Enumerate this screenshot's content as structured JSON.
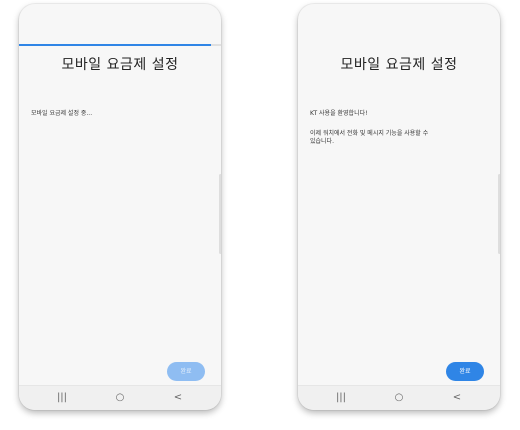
{
  "screens": [
    {
      "title": "모바일 요금제 설정",
      "progress_percent": 95,
      "lines": [
        "모바일 요금제 설정 중..."
      ],
      "done_label": "완료",
      "done_enabled": false
    },
    {
      "title": "모바일 요금제 설정",
      "lines": [
        "KT 사용을 환영합니다!",
        "이제 워치에서 전화 및 메시지 기능을 사용할 수",
        "있습니다."
      ],
      "done_label": "완료",
      "done_enabled": true
    }
  ],
  "nav": {
    "recent": "|||",
    "home": "○",
    "back": "<"
  },
  "colors": {
    "accent": "#2f85e6",
    "background": "#f7f7f7"
  }
}
